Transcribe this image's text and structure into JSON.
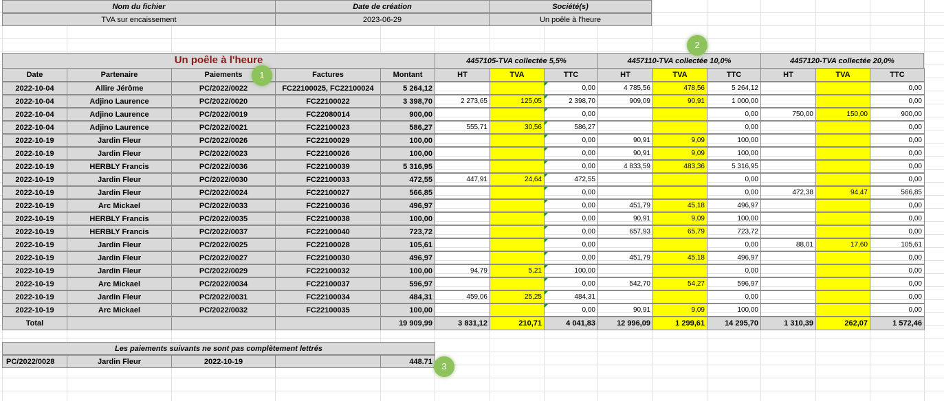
{
  "meta": {
    "headers": [
      "Nom du fichier",
      "Date de création",
      "Société(s)"
    ],
    "values": [
      "TVA sur encaissement",
      "2023-06-29",
      "Un poêle à l'heure"
    ]
  },
  "table": {
    "title": "Un poêle à l'heure",
    "groups": [
      "4457105-TVA collectée 5,5%",
      "4457110-TVA collectée 10,0%",
      "4457120-TVA collectée 20,0%"
    ],
    "columns": [
      "Date",
      "Partenaire",
      "Paiements",
      "Factures",
      "Montant",
      "HT",
      "TVA",
      "TTC",
      "HT",
      "TVA",
      "TTC",
      "HT",
      "TVA",
      "TTC"
    ],
    "rows": [
      [
        "2022-10-04",
        "Allire Jérôme",
        "PC/2022/0022",
        "FC22100025, FC22100024",
        "5 264,12",
        "",
        "",
        "0,00",
        "4 785,56",
        "478,56",
        "5 264,12",
        "",
        "",
        "0,00"
      ],
      [
        "2022-10-04",
        "Adjino Laurence",
        "PC/2022/0020",
        "FC22100022",
        "3 398,70",
        "2 273,65",
        "125,05",
        "2 398,70",
        "909,09",
        "90,91",
        "1 000,00",
        "",
        "",
        "0,00"
      ],
      [
        "2022-10-04",
        "Adjino Laurence",
        "PC/2022/0019",
        "FC22080014",
        "900,00",
        "",
        "",
        "0,00",
        "",
        "",
        "0,00",
        "750,00",
        "150,00",
        "900,00"
      ],
      [
        "2022-10-04",
        "Adjino Laurence",
        "PC/2022/0021",
        "FC22100023",
        "586,27",
        "555,71",
        "30,56",
        "586,27",
        "",
        "",
        "0,00",
        "",
        "",
        "0,00"
      ],
      [
        "2022-10-19",
        "Jardin Fleur",
        "PC/2022/0026",
        "FC22100029",
        "100,00",
        "",
        "",
        "0,00",
        "90,91",
        "9,09",
        "100,00",
        "",
        "",
        "0,00"
      ],
      [
        "2022-10-19",
        "Jardin Fleur",
        "PC/2022/0023",
        "FC22100026",
        "100,00",
        "",
        "",
        "0,00",
        "90,91",
        "9,09",
        "100,00",
        "",
        "",
        "0,00"
      ],
      [
        "2022-10-19",
        "HERBLY Francis",
        "PC/2022/0036",
        "FC22100039",
        "5 316,95",
        "",
        "",
        "0,00",
        "4 833,59",
        "483,36",
        "5 316,95",
        "",
        "",
        "0,00"
      ],
      [
        "2022-10-19",
        "Jardin Fleur",
        "PC/2022/0030",
        "FC22100033",
        "472,55",
        "447,91",
        "24,64",
        "472,55",
        "",
        "",
        "0,00",
        "",
        "",
        "0,00"
      ],
      [
        "2022-10-19",
        "Jardin Fleur",
        "PC/2022/0024",
        "FC22100027",
        "566,85",
        "",
        "",
        "0,00",
        "",
        "",
        "0,00",
        "472,38",
        "94,47",
        "566,85"
      ],
      [
        "2022-10-19",
        "Arc Mickael",
        "PC/2022/0033",
        "FC22100036",
        "496,97",
        "",
        "",
        "0,00",
        "451,79",
        "45,18",
        "496,97",
        "",
        "",
        "0,00"
      ],
      [
        "2022-10-19",
        "HERBLY Francis",
        "PC/2022/0035",
        "FC22100038",
        "100,00",
        "",
        "",
        "0,00",
        "90,91",
        "9,09",
        "100,00",
        "",
        "",
        "0,00"
      ],
      [
        "2022-10-19",
        "HERBLY Francis",
        "PC/2022/0037",
        "FC22100040",
        "723,72",
        "",
        "",
        "0,00",
        "657,93",
        "65,79",
        "723,72",
        "",
        "",
        "0,00"
      ],
      [
        "2022-10-19",
        "Jardin Fleur",
        "PC/2022/0025",
        "FC22100028",
        "105,61",
        "",
        "",
        "0,00",
        "",
        "",
        "0,00",
        "88,01",
        "17,60",
        "105,61"
      ],
      [
        "2022-10-19",
        "Jardin Fleur",
        "PC/2022/0027",
        "FC22100030",
        "496,97",
        "",
        "",
        "0,00",
        "451,79",
        "45,18",
        "496,97",
        "",
        "",
        "0,00"
      ],
      [
        "2022-10-19",
        "Jardin Fleur",
        "PC/2022/0029",
        "FC22100032",
        "100,00",
        "94,79",
        "5,21",
        "100,00",
        "",
        "",
        "0,00",
        "",
        "",
        "0,00"
      ],
      [
        "2022-10-19",
        "Arc Mickael",
        "PC/2022/0034",
        "FC22100037",
        "596,97",
        "",
        "",
        "0,00",
        "542,70",
        "54,27",
        "596,97",
        "",
        "",
        "0,00"
      ],
      [
        "2022-10-19",
        "Jardin Fleur",
        "PC/2022/0031",
        "FC22100034",
        "484,31",
        "459,06",
        "25,25",
        "484,31",
        "",
        "",
        "0,00",
        "",
        "",
        "0,00"
      ],
      [
        "2022-10-19",
        "Arc Mickael",
        "PC/2022/0032",
        "FC22100035",
        "100,00",
        "",
        "",
        "0,00",
        "90,91",
        "9,09",
        "100,00",
        "",
        "",
        "0,00"
      ]
    ],
    "total": [
      "Total",
      "",
      "",
      "",
      "19 909,99",
      "3 831,12",
      "210,71",
      "4 041,83",
      "12 996,09",
      "1 299,61",
      "14 295,70",
      "1 310,39",
      "262,07",
      "1 572,46"
    ]
  },
  "unlettered": {
    "title": "Les paiements suivants ne sont pas complètement lettrés",
    "row": [
      "PC/2022/0028",
      "Jardin Fleur",
      "2022-10-19",
      "",
      "448.71"
    ]
  },
  "badges": [
    "1",
    "2",
    "3"
  ],
  "colors": {
    "header_gray": "#d9d9d9",
    "highlight": "#ffff00",
    "title_red": "#8b1a1a",
    "badge_green": "#8dc25c"
  }
}
